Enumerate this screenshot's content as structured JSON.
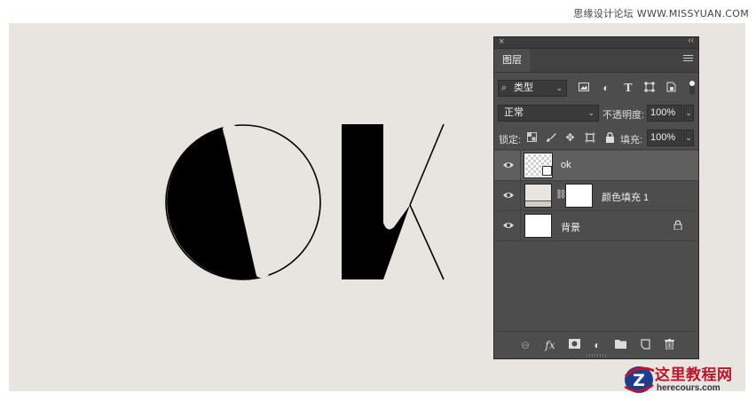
{
  "watermark": {
    "text": "思缘设计论坛 WWW.MISSYUAN.COM"
  },
  "colors": {
    "canvas": "#e8e4e0",
    "panel": "#4d4d4d",
    "selected_row": "#5f5f5f",
    "logo_red": "#c0142a"
  },
  "panel": {
    "close_icon": "close-icon",
    "collapse_icon": "double-chevron-icon",
    "tab_label": "图层",
    "menu_icon": "panel-menu-icon",
    "filter": {
      "kind_label": "类型",
      "icons": [
        "image-filter-icon",
        "adjustment-filter-icon",
        "type-filter-icon",
        "shape-filter-icon",
        "smart-object-filter-icon"
      ]
    },
    "blend_mode": "正常",
    "opacity_label": "不透明度:",
    "opacity_value": "100%",
    "lock_label": "锁定:",
    "fill_label": "填充:",
    "fill_value": "100%",
    "layers": [
      {
        "name": "ok",
        "selected": true,
        "visible": true,
        "type": "smart-object"
      },
      {
        "name": "颜色填充 1",
        "selected": false,
        "visible": true,
        "type": "fill"
      },
      {
        "name": "背景",
        "selected": false,
        "visible": true,
        "type": "background",
        "locked": true
      }
    ],
    "bottom_icons": [
      "link-icon",
      "fx-icon",
      "mask-icon",
      "adjustment-icon",
      "folder-icon",
      "new-layer-icon",
      "trash-icon"
    ]
  },
  "logo": {
    "title": "这里教程网",
    "subtitle": "herecours.com",
    "mark": "Z"
  }
}
